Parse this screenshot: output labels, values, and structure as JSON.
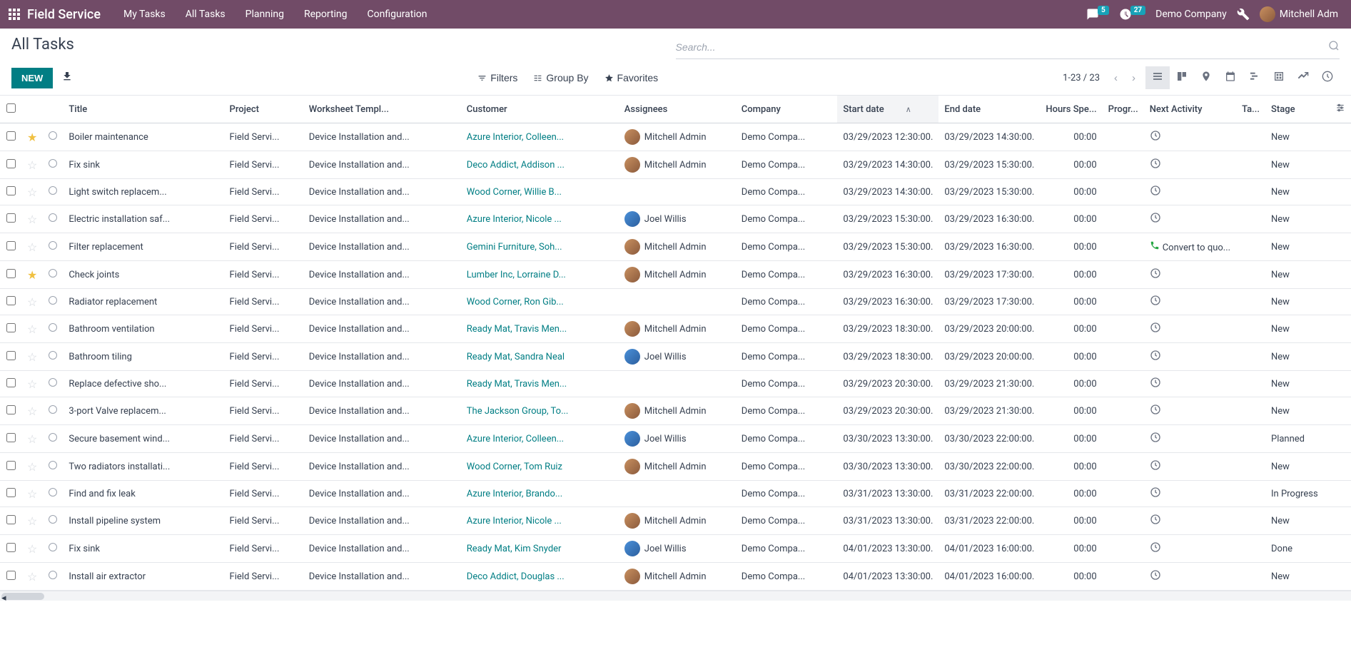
{
  "nav": {
    "app_title": "Field Service",
    "menu": [
      "My Tasks",
      "All Tasks",
      "Planning",
      "Reporting",
      "Configuration"
    ],
    "msg_badge": "5",
    "activity_badge": "27",
    "company": "Demo Company",
    "user": "Mitchell Adm"
  },
  "cp": {
    "title": "All Tasks",
    "search_placeholder": "Search...",
    "new_label": "New",
    "filters_label": "Filters",
    "groupby_label": "Group By",
    "favorites_label": "Favorites",
    "pager": "1-23 / 23"
  },
  "columns": {
    "title": "Title",
    "project": "Project",
    "template": "Worksheet Templ...",
    "customer": "Customer",
    "assignees": "Assignees",
    "company": "Company",
    "start": "Start date",
    "end": "End date",
    "hours": "Hours Spe...",
    "progress": "Progr...",
    "activity": "Next Activity",
    "tags": "Ta...",
    "stage": "Stage"
  },
  "rows": [
    {
      "star": true,
      "title": "Boiler maintenance",
      "project": "Field Servi...",
      "template": "Device Installation and...",
      "customer": "Azure Interior, Colleen...",
      "assignee": "Mitchell Admin",
      "av": "ma",
      "company": "Demo Compa...",
      "start": "03/29/2023 12:30:00.",
      "end": "03/29/2023 14:30:00.",
      "hours": "00:00",
      "activity": "clock",
      "stage": "New"
    },
    {
      "star": false,
      "title": "Fix sink",
      "project": "Field Servi...",
      "template": "Device Installation and...",
      "customer": "Deco Addict, Addison ...",
      "assignee": "Mitchell Admin",
      "av": "ma",
      "company": "Demo Compa...",
      "start": "03/29/2023 14:30:00.",
      "end": "03/29/2023 15:30:00.",
      "hours": "00:00",
      "activity": "clock",
      "stage": "New"
    },
    {
      "star": false,
      "title": "Light switch replacem...",
      "project": "Field Servi...",
      "template": "Device Installation and...",
      "customer": "Wood Corner, Willie B...",
      "assignee": "",
      "av": "",
      "company": "Demo Compa...",
      "start": "03/29/2023 14:30:00.",
      "end": "03/29/2023 15:30:00.",
      "hours": "00:00",
      "activity": "clock",
      "stage": "New"
    },
    {
      "star": false,
      "title": "Electric installation saf...",
      "project": "Field Servi...",
      "template": "Device Installation and...",
      "customer": "Azure Interior, Nicole ...",
      "assignee": "Joel Willis",
      "av": "jw",
      "company": "Demo Compa...",
      "start": "03/29/2023 15:30:00.",
      "end": "03/29/2023 16:30:00.",
      "hours": "00:00",
      "activity": "clock",
      "stage": "New"
    },
    {
      "star": false,
      "title": "Filter replacement",
      "project": "Field Servi...",
      "template": "Device Installation and...",
      "customer": "Gemini Furniture, Soh...",
      "assignee": "Mitchell Admin",
      "av": "ma",
      "company": "Demo Compa...",
      "start": "03/29/2023 15:30:00.",
      "end": "03/29/2023 16:30:00.",
      "hours": "00:00",
      "activity": "phone",
      "activity_text": "Convert to quo...",
      "stage": "New"
    },
    {
      "star": true,
      "title": "Check joints",
      "project": "Field Servi...",
      "template": "Device Installation and...",
      "customer": "Lumber Inc, Lorraine D...",
      "assignee": "Mitchell Admin",
      "av": "ma",
      "company": "Demo Compa...",
      "start": "03/29/2023 16:30:00.",
      "end": "03/29/2023 17:30:00.",
      "hours": "00:00",
      "activity": "clock",
      "stage": "New"
    },
    {
      "star": false,
      "title": "Radiator replacement",
      "project": "Field Servi...",
      "template": "Device Installation and...",
      "customer": "Wood Corner, Ron Gib...",
      "assignee": "",
      "av": "",
      "company": "Demo Compa...",
      "start": "03/29/2023 16:30:00.",
      "end": "03/29/2023 17:30:00.",
      "hours": "00:00",
      "activity": "clock",
      "stage": "New"
    },
    {
      "star": false,
      "title": "Bathroom ventilation",
      "project": "Field Servi...",
      "template": "Device Installation and...",
      "customer": "Ready Mat, Travis Men...",
      "assignee": "Mitchell Admin",
      "av": "ma",
      "company": "Demo Compa...",
      "start": "03/29/2023 18:30:00.",
      "end": "03/29/2023 20:00:00.",
      "hours": "00:00",
      "activity": "clock",
      "stage": "New"
    },
    {
      "star": false,
      "title": "Bathroom tiling",
      "project": "Field Servi...",
      "template": "Device Installation and...",
      "customer": "Ready Mat, Sandra Neal",
      "assignee": "Joel Willis",
      "av": "jw",
      "company": "Demo Compa...",
      "start": "03/29/2023 18:30:00.",
      "end": "03/29/2023 20:00:00.",
      "hours": "00:00",
      "activity": "clock",
      "stage": "New"
    },
    {
      "star": false,
      "title": "Replace defective sho...",
      "project": "Field Servi...",
      "template": "Device Installation and...",
      "customer": "Ready Mat, Travis Men...",
      "assignee": "",
      "av": "",
      "company": "Demo Compa...",
      "start": "03/29/2023 20:30:00.",
      "end": "03/29/2023 21:30:00.",
      "hours": "00:00",
      "activity": "clock",
      "stage": "New"
    },
    {
      "star": false,
      "title": "3-port Valve replacem...",
      "project": "Field Servi...",
      "template": "Device Installation and...",
      "customer": "The Jackson Group, To...",
      "assignee": "Mitchell Admin",
      "av": "ma",
      "company": "Demo Compa...",
      "start": "03/29/2023 20:30:00.",
      "end": "03/29/2023 21:30:00.",
      "hours": "00:00",
      "activity": "clock",
      "stage": "New"
    },
    {
      "star": false,
      "title": "Secure basement wind...",
      "project": "Field Servi...",
      "template": "Device Installation and...",
      "customer": "Azure Interior, Colleen...",
      "assignee": "Joel Willis",
      "av": "jw",
      "company": "Demo Compa...",
      "start": "03/30/2023 13:30:00.",
      "end": "03/30/2023 22:00:00.",
      "hours": "00:00",
      "activity": "clock",
      "stage": "Planned"
    },
    {
      "star": false,
      "title": "Two radiators installati...",
      "project": "Field Servi...",
      "template": "Device Installation and...",
      "customer": "Wood Corner, Tom Ruiz",
      "assignee": "Mitchell Admin",
      "av": "ma",
      "company": "Demo Compa...",
      "start": "03/30/2023 13:30:00.",
      "end": "03/30/2023 22:00:00.",
      "hours": "00:00",
      "activity": "clock",
      "stage": "New"
    },
    {
      "star": false,
      "title": "Find and fix leak",
      "project": "Field Servi...",
      "template": "Device Installation and...",
      "customer": "Azure Interior, Brando...",
      "assignee": "",
      "av": "",
      "company": "Demo Compa...",
      "start": "03/31/2023 13:30:00.",
      "end": "03/31/2023 22:00:00.",
      "hours": "00:00",
      "activity": "clock",
      "stage": "In Progress"
    },
    {
      "star": false,
      "title": "Install pipeline system",
      "project": "Field Servi...",
      "template": "Device Installation and...",
      "customer": "Azure Interior, Nicole ...",
      "assignee": "Mitchell Admin",
      "av": "ma",
      "company": "Demo Compa...",
      "start": "03/31/2023 13:30:00.",
      "end": "03/31/2023 22:00:00.",
      "hours": "00:00",
      "activity": "clock",
      "stage": "New"
    },
    {
      "star": false,
      "title": "Fix sink",
      "project": "Field Servi...",
      "template": "Device Installation and...",
      "customer": "Ready Mat, Kim Snyder",
      "assignee": "Joel Willis",
      "av": "jw",
      "company": "Demo Compa...",
      "start": "04/01/2023 13:30:00.",
      "end": "04/01/2023 16:00:00.",
      "hours": "00:00",
      "activity": "clock",
      "stage": "Done"
    },
    {
      "star": false,
      "title": "Install air extractor",
      "project": "Field Servi...",
      "template": "Device Installation and...",
      "customer": "Deco Addict, Douglas ...",
      "assignee": "Mitchell Admin",
      "av": "ma",
      "company": "Demo Compa...",
      "start": "04/01/2023 13:30:00.",
      "end": "04/01/2023 16:00:00.",
      "hours": "00:00",
      "activity": "clock",
      "stage": "New"
    }
  ]
}
